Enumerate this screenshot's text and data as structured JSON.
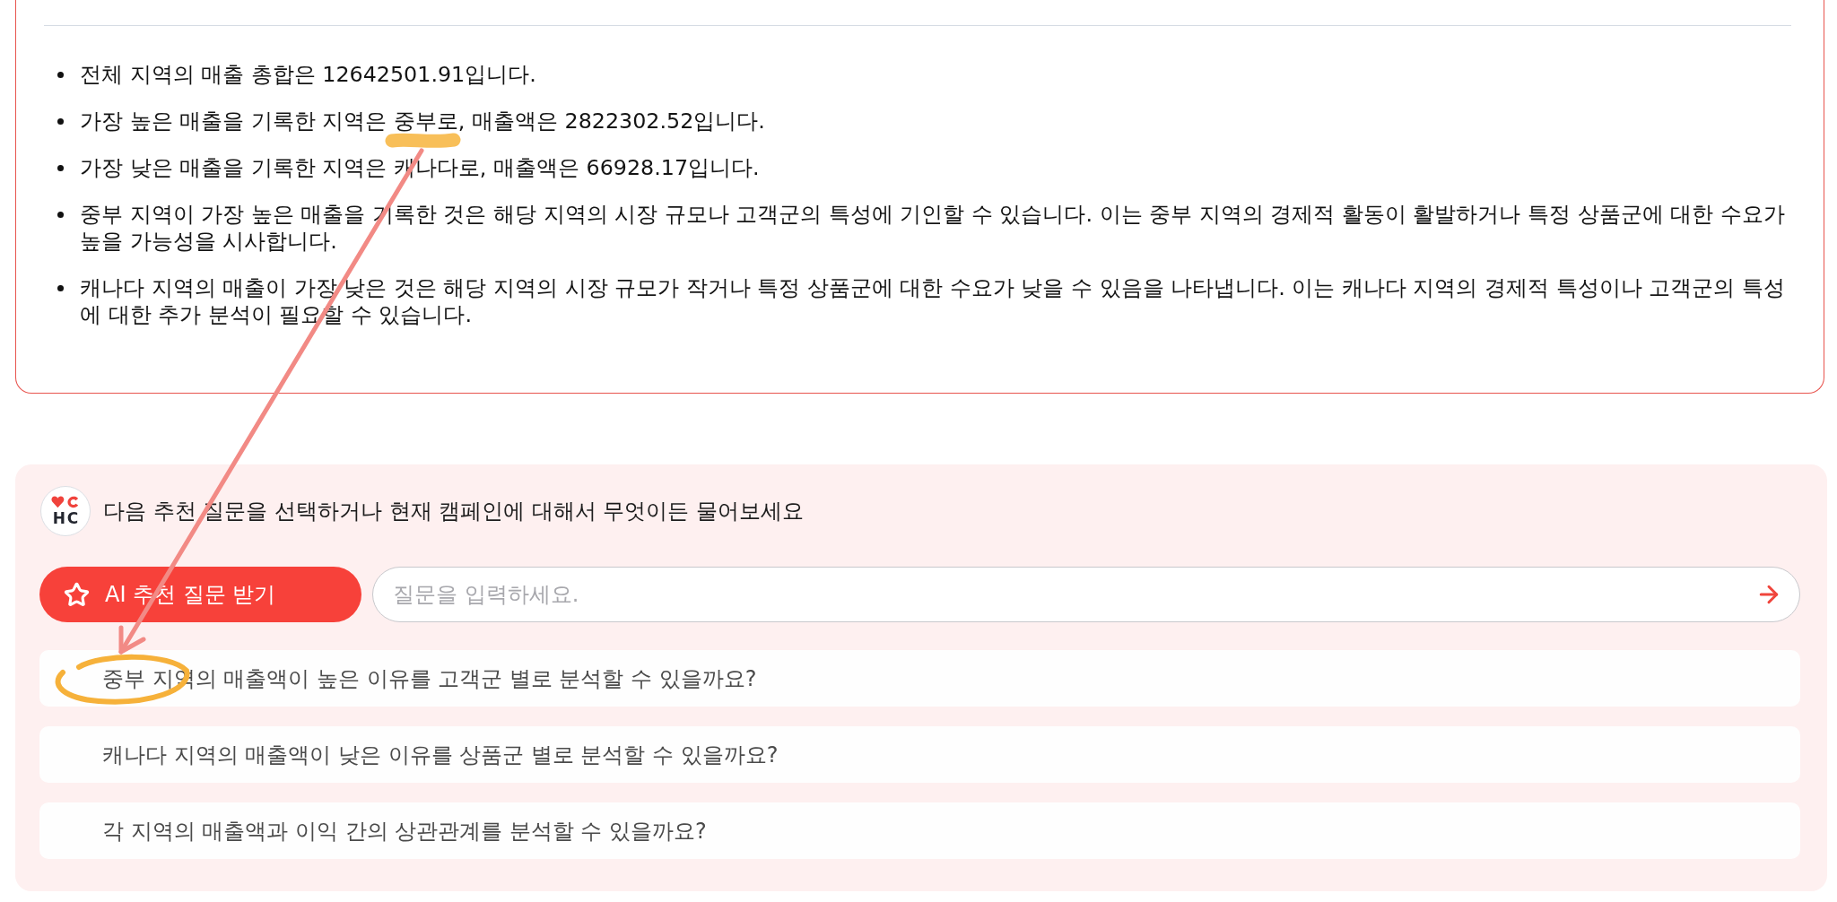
{
  "summary_card": {
    "bullets": [
      "전체 지역의 매출 총합은 12642501.91입니다.",
      "가장 높은 매출을 기록한 지역은 중부로, 매출액은 2822302.52입니다.",
      "가장 낮은 매출을 기록한 지역은 캐나다로, 매출액은 66928.17입니다.",
      "중부 지역이 가장 높은 매출을 기록한 것은 해당 지역의 시장 규모나 고객군의 특성에 기인할 수 있습니다. 이는 중부 지역의 경제적 활동이 활발하거나 특정 상품군에 대한 수요가 높을 가능성을 시사합니다.",
      "캐나다 지역의 매출이 가장 낮은 것은 해당 지역의 시장 규모가 작거나 특정 상품군에 대한 수요가 낮을 수 있음을 나타냅니다. 이는 캐나다 지역의 경제적 특성이나 고객군의 특성에 대한 추가 분석이 필요할 수 있습니다."
    ]
  },
  "question_panel": {
    "logo_text": "HC",
    "prompt": "다음 추천 질문을 선택하거나 현재 캠페인에 대해서 무엇이든 물어보세요",
    "ai_button": {
      "label": "AI 추천 질문 받기"
    },
    "question_input": {
      "placeholder": "질문을 입력하세요."
    },
    "suggestions": [
      "중부 지역의 매출액이 높은 이유를 고객군 별로 분석할 수 있을까요?",
      "캐나다 지역의 매출액이 낮은 이유를 상품군 별로 분석할 수 있을까요?",
      "각 지역의 매출액과 이익 간의 상관관계를 분석할 수 있을까요?"
    ]
  },
  "annotations": [
    {
      "kind": "highlight"
    },
    {
      "kind": "arrow"
    },
    {
      "kind": "loop"
    }
  ]
}
